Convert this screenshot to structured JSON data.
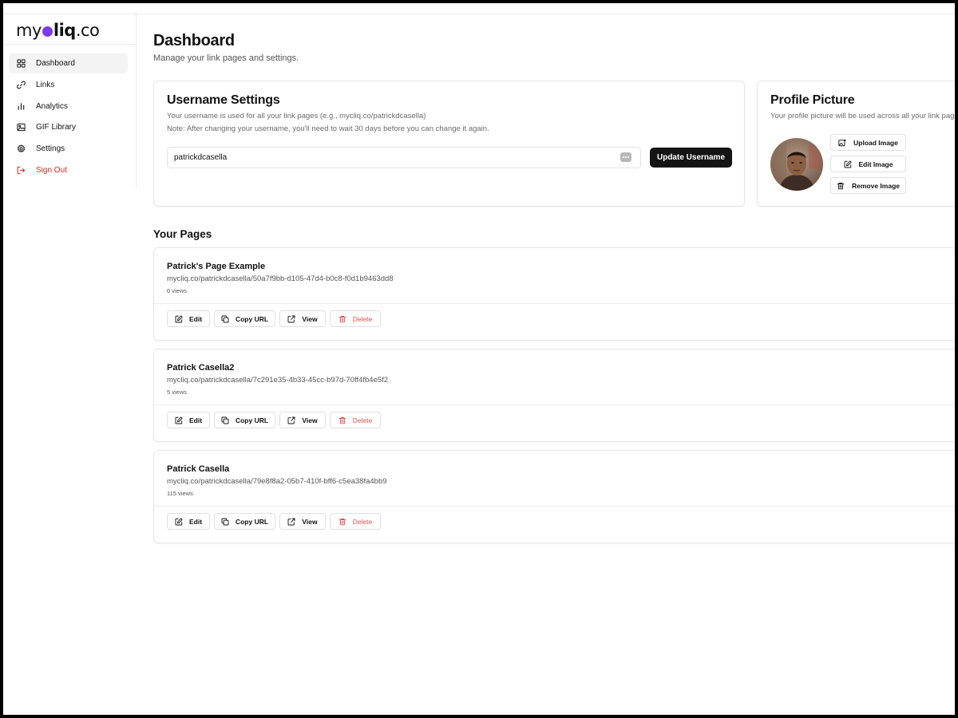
{
  "brand": {
    "prefix": "my",
    "mid": "liq",
    "suffix": ".co"
  },
  "sidebar": {
    "items": [
      {
        "label": "Dashboard",
        "icon": "grid-icon",
        "active": true
      },
      {
        "label": "Links",
        "icon": "link-icon"
      },
      {
        "label": "Analytics",
        "icon": "bar-chart-icon"
      },
      {
        "label": "GIF Library",
        "icon": "image-icon"
      },
      {
        "label": "Settings",
        "icon": "gear-icon"
      },
      {
        "label": "Sign Out",
        "icon": "sign-out-icon",
        "color": "#dc2626"
      }
    ]
  },
  "header": {
    "title": "Dashboard",
    "subtitle": "Manage your link pages and settings."
  },
  "username_settings": {
    "title": "Username Settings",
    "description": "Your username is used for all your link pages (e.g., mycliq.co/patrickdcasella)",
    "note": "Note: After changing your username, you'll need to wait 30 days before you can change it again.",
    "username_value": "patrickdcasella",
    "button_label": "Update Username"
  },
  "profile_picture": {
    "title": "Profile Picture",
    "description": "Your profile picture will be used across all your link pages.",
    "buttons": {
      "upload": "Upload Image",
      "edit": "Edit Image",
      "remove": "Remove Image"
    }
  },
  "pages_section": {
    "title": "Your Pages",
    "actions": {
      "edit": "Edit",
      "copy": "Copy URL",
      "view": "View",
      "delete": "Delete"
    },
    "pages": [
      {
        "name": "Patrick's Page Example",
        "url": "mycliq.co/patrickdcasella/50a7f9bb-d105-47d4-b0c8-f0d1b9463dd8",
        "views": "0 views"
      },
      {
        "name": "Patrick Casella2",
        "url": "mycliq.co/patrickdcasella/7c291e35-4b33-45cc-b97d-70ff4fb4e5f2",
        "views": "5 views"
      },
      {
        "name": "Patrick Casella",
        "url": "mycliq.co/patrickdcasella/79e8f8a2-05b7-410f-bff6-c5ea38fa4bb9",
        "views": "115 views"
      }
    ]
  },
  "colors": {
    "accent": "#7c3aed",
    "primary_button": "#141414",
    "danger": "#dc2626"
  }
}
